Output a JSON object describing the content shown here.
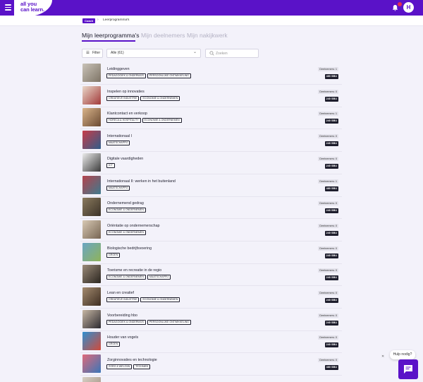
{
  "app": {
    "logo_line1": "all you",
    "logo_line2": "can learn.",
    "avatar_initial": "H",
    "brand_color": "#5a12c8"
  },
  "breadcrumb": {
    "badge": "Coach",
    "separator": "›",
    "current": "Leerprogramma's"
  },
  "tabs": [
    {
      "label": "Mijn leerprogramma's",
      "active": true
    },
    {
      "label": "Mijn deelnemers",
      "active": false
    },
    {
      "label": "Mijn nakijkwerk",
      "active": false
    }
  ],
  "filters": {
    "filter_label": "Filter",
    "select_value": "Alle (61)",
    "search_placeholder": "Zoeken"
  },
  "programs": [
    {
      "title": "Leidinggeven",
      "tags": [
        "PEDAGOGIEK & ONDERWIJS",
        "PERSOONLIJKE ONTWIKKELING"
      ],
      "participants": "Deelnemers: 1",
      "sbu": "480 SBU",
      "thumb": [
        "#c9c3b8",
        "#7e7466"
      ]
    },
    {
      "title": "Inspelen op innovaties",
      "tags": [
        "CREATIEVE INDUSTRIE",
        "ECONOMIE & ONDERNEMEN"
      ],
      "participants": "Deelnemers: 0",
      "sbu": "240 SBU",
      "thumb": [
        "#e9d7c9",
        "#a23a3a"
      ]
    },
    {
      "title": "Klantcontact en verkoop",
      "tags": [
        "HORECA & HOSPITALITY",
        "ECONOMIE & ONDERNEMEN"
      ],
      "participants": "Deelnemers: 1",
      "sbu": "240 SBU",
      "thumb": [
        "#d9b48a",
        "#6a4a32"
      ]
    },
    {
      "title": "Internationaal I",
      "tags": [
        "MAATSCHAPPIJ"
      ],
      "participants": "Deelnemers: 0",
      "sbu": "240 SBU",
      "thumb": [
        "#c83c48",
        "#2f5d8a"
      ]
    },
    {
      "title": "Digitale vaardigheden",
      "tags": [
        "ICT"
      ],
      "participants": "Deelnemers: 0",
      "sbu": "240 SBU",
      "thumb": [
        "#ececec",
        "#3b3b3b"
      ]
    },
    {
      "title": "Internationaal II: werken in het buitenland",
      "tags": [
        "MAATSCHAPPIJ"
      ],
      "participants": "Deelnemers: 1",
      "sbu": "480 SBU",
      "thumb": [
        "#b5434d",
        "#3e7a8e"
      ]
    },
    {
      "title": "Ondernemend gedrag",
      "tags": [
        "ECONOMIE & ONDERNEMEN"
      ],
      "participants": "Deelnemers: 0",
      "sbu": "240 SBU",
      "thumb": [
        "#8a7a5e",
        "#3c3328"
      ]
    },
    {
      "title": "Oriëntatie op ondernemerschap",
      "tags": [
        "ECONOMIE & ONDERNEMEN"
      ],
      "participants": "Deelnemers: 0",
      "sbu": "240 SBU",
      "thumb": [
        "#d8c9b4",
        "#776553"
      ]
    },
    {
      "title": "Biologische bedrijfsvoering",
      "tags": [
        "GROEN"
      ],
      "participants": "Deelnemers: 0",
      "sbu": "240 SBU",
      "thumb": [
        "#6aa6c4",
        "#8fb35a"
      ]
    },
    {
      "title": "Toerisme en recreatie in de regio",
      "tags": [
        "ECONOMIE & ONDERNEMEN",
        "MAATSCHAPPIJ"
      ],
      "participants": "Deelnemers: 0",
      "sbu": "240 SBU",
      "thumb": [
        "#9a8a78",
        "#2b2620"
      ]
    },
    {
      "title": "Lean en creatief",
      "tags": [
        "CREATIEVE INDUSTRIE",
        "ECONOMIE & ONDERNEMEN"
      ],
      "participants": "Deelnemers: 0",
      "sbu": "240 SBU",
      "thumb": [
        "#a38a6e",
        "#3e2e22"
      ]
    },
    {
      "title": "Voorbereiding hbo",
      "tags": [
        "PEDAGOGIEK & ONDERWIJS",
        "PERSOONLIJKE ONTWIKKELING"
      ],
      "participants": "Deelnemers: 0",
      "sbu": "240 SBU",
      "thumb": [
        "#c7b7a4",
        "#2c2a30"
      ]
    },
    {
      "title": "Houder van vogels",
      "tags": [
        "GROEN"
      ],
      "participants": "Deelnemers: 0",
      "sbu": "240 SBU",
      "thumb": [
        "#2f8fd0",
        "#d14a3a"
      ]
    },
    {
      "title": "Zorginnovaties en technologie",
      "tags": [
        "ZORG & WELZIJN",
        "TECHNIEK"
      ],
      "participants": "Deelnemers: 0",
      "sbu": "480 SBU",
      "thumb": [
        "#e06a7a",
        "#3a76b8"
      ]
    },
    {
      "title": "",
      "tags": [],
      "participants": "",
      "sbu": "",
      "thumb": [
        "#d7cfc4",
        "#9b8c7c"
      ]
    }
  ],
  "help": {
    "label": "Hulp nodig?",
    "close": "✕"
  }
}
